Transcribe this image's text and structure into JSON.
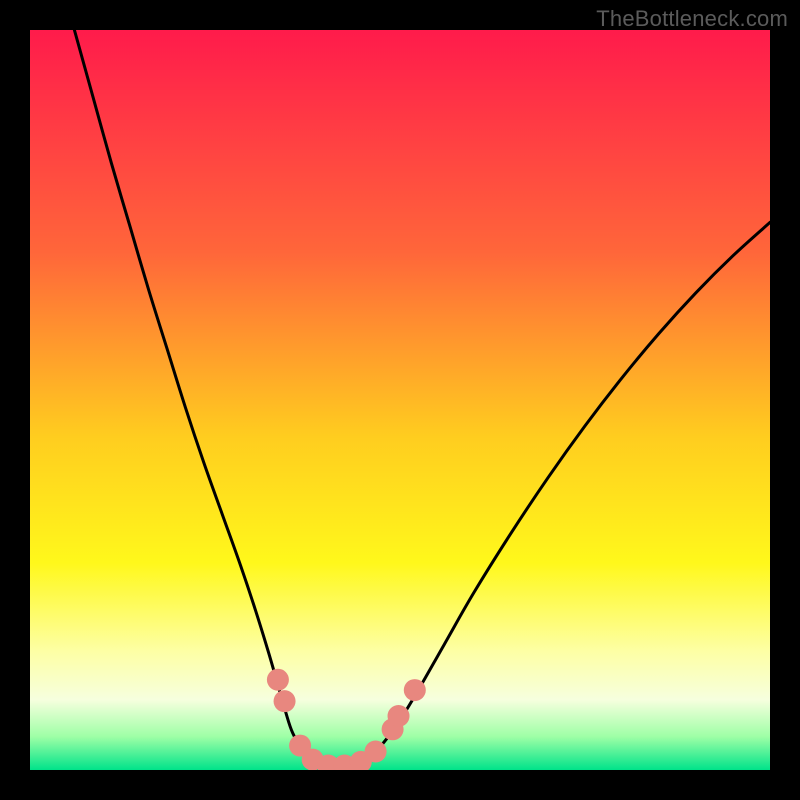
{
  "watermark": "TheBottleneck.com",
  "chart_data": {
    "type": "line",
    "title": "",
    "xlabel": "",
    "ylabel": "",
    "xlim": [
      0,
      1
    ],
    "ylim": [
      0,
      1
    ],
    "gradient_stops": [
      {
        "offset": 0.0,
        "color": "#ff1b4b"
      },
      {
        "offset": 0.3,
        "color": "#ff663a"
      },
      {
        "offset": 0.55,
        "color": "#ffcd1f"
      },
      {
        "offset": 0.72,
        "color": "#fff81b"
      },
      {
        "offset": 0.84,
        "color": "#fdffa5"
      },
      {
        "offset": 0.905,
        "color": "#f6ffde"
      },
      {
        "offset": 0.955,
        "color": "#9effa6"
      },
      {
        "offset": 1.0,
        "color": "#00e38a"
      }
    ],
    "series": [
      {
        "name": "curve-left",
        "stroke": "#000000",
        "stroke_width": 3,
        "points": [
          {
            "x": 0.06,
            "y": 1.0
          },
          {
            "x": 0.085,
            "y": 0.91
          },
          {
            "x": 0.11,
            "y": 0.82
          },
          {
            "x": 0.135,
            "y": 0.735
          },
          {
            "x": 0.16,
            "y": 0.65
          },
          {
            "x": 0.185,
            "y": 0.57
          },
          {
            "x": 0.21,
            "y": 0.49
          },
          {
            "x": 0.235,
            "y": 0.415
          },
          {
            "x": 0.26,
            "y": 0.345
          },
          {
            "x": 0.285,
            "y": 0.275
          },
          {
            "x": 0.305,
            "y": 0.215
          },
          {
            "x": 0.322,
            "y": 0.16
          },
          {
            "x": 0.335,
            "y": 0.115
          },
          {
            "x": 0.345,
            "y": 0.08
          },
          {
            "x": 0.355,
            "y": 0.05
          },
          {
            "x": 0.37,
            "y": 0.025
          },
          {
            "x": 0.39,
            "y": 0.01
          },
          {
            "x": 0.41,
            "y": 0.005
          }
        ]
      },
      {
        "name": "curve-right",
        "stroke": "#000000",
        "stroke_width": 3,
        "points": [
          {
            "x": 0.41,
            "y": 0.005
          },
          {
            "x": 0.43,
            "y": 0.006
          },
          {
            "x": 0.45,
            "y": 0.012
          },
          {
            "x": 0.47,
            "y": 0.028
          },
          {
            "x": 0.495,
            "y": 0.06
          },
          {
            "x": 0.52,
            "y": 0.1
          },
          {
            "x": 0.56,
            "y": 0.17
          },
          {
            "x": 0.6,
            "y": 0.24
          },
          {
            "x": 0.65,
            "y": 0.32
          },
          {
            "x": 0.7,
            "y": 0.395
          },
          {
            "x": 0.75,
            "y": 0.465
          },
          {
            "x": 0.8,
            "y": 0.53
          },
          {
            "x": 0.85,
            "y": 0.59
          },
          {
            "x": 0.9,
            "y": 0.645
          },
          {
            "x": 0.95,
            "y": 0.695
          },
          {
            "x": 1.0,
            "y": 0.74
          }
        ]
      }
    ],
    "markers": {
      "color": "#e8877f",
      "radius": 11,
      "points": [
        {
          "x": 0.335,
          "y": 0.122
        },
        {
          "x": 0.344,
          "y": 0.093
        },
        {
          "x": 0.365,
          "y": 0.033
        },
        {
          "x": 0.382,
          "y": 0.014
        },
        {
          "x": 0.403,
          "y": 0.006
        },
        {
          "x": 0.425,
          "y": 0.006
        },
        {
          "x": 0.447,
          "y": 0.011
        },
        {
          "x": 0.467,
          "y": 0.025
        },
        {
          "x": 0.49,
          "y": 0.055
        },
        {
          "x": 0.498,
          "y": 0.073
        },
        {
          "x": 0.52,
          "y": 0.108
        }
      ]
    }
  }
}
